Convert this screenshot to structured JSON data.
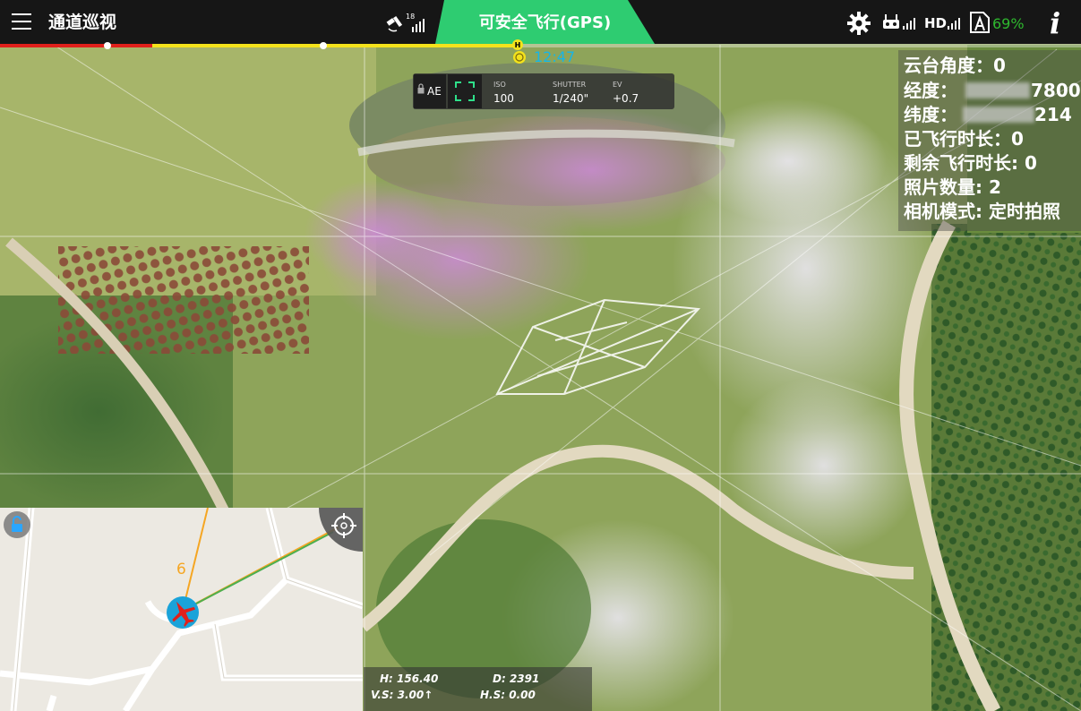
{
  "header": {
    "menu_icon": "hamburger-menu-icon",
    "mission_title": "通道巡视",
    "gps_satellite_count": "18",
    "flight_status": "可安全飞行(GPS)",
    "settings_icon": "gear-icon",
    "hd_label": "HD",
    "battery_percent": "69%",
    "info_icon": "info-icon",
    "colors": {
      "status_green": "#2ecc71",
      "battery_green": "#2eb82e",
      "flight_time_blue": "#16b5e8"
    }
  },
  "timeline": {
    "home_marker": "H",
    "flight_time": "12:47"
  },
  "camera": {
    "ae_label": "AE",
    "iso_label": "ISO",
    "iso_value": "100",
    "shutter_label": "SHUTTER",
    "shutter_value": "1/240\"",
    "ev_label": "EV",
    "ev_value": "+0.7"
  },
  "flight_info": {
    "gimbal_angle": "云台角度：0",
    "longitude": "经度：",
    "longitude_visible": "7800",
    "latitude": "纬度：",
    "latitude_visible": "214",
    "flown_time": "已飞行时长：0",
    "remaining_time": "剩余飞行时长: 0",
    "photo_count": "照片数量: 2",
    "camera_mode": "相机模式: 定时拍照"
  },
  "minimap": {
    "distance": "6",
    "lock_icon": "lock-icon",
    "recenter_icon": "crosshair-icon",
    "aircraft_icon": "aircraft-icon"
  },
  "telemetry": {
    "height": "H: 156.40",
    "distance": "D: 2391",
    "vertical_speed": "V.S: 3.00↑",
    "horizontal_speed": "H.S: 0.00"
  }
}
